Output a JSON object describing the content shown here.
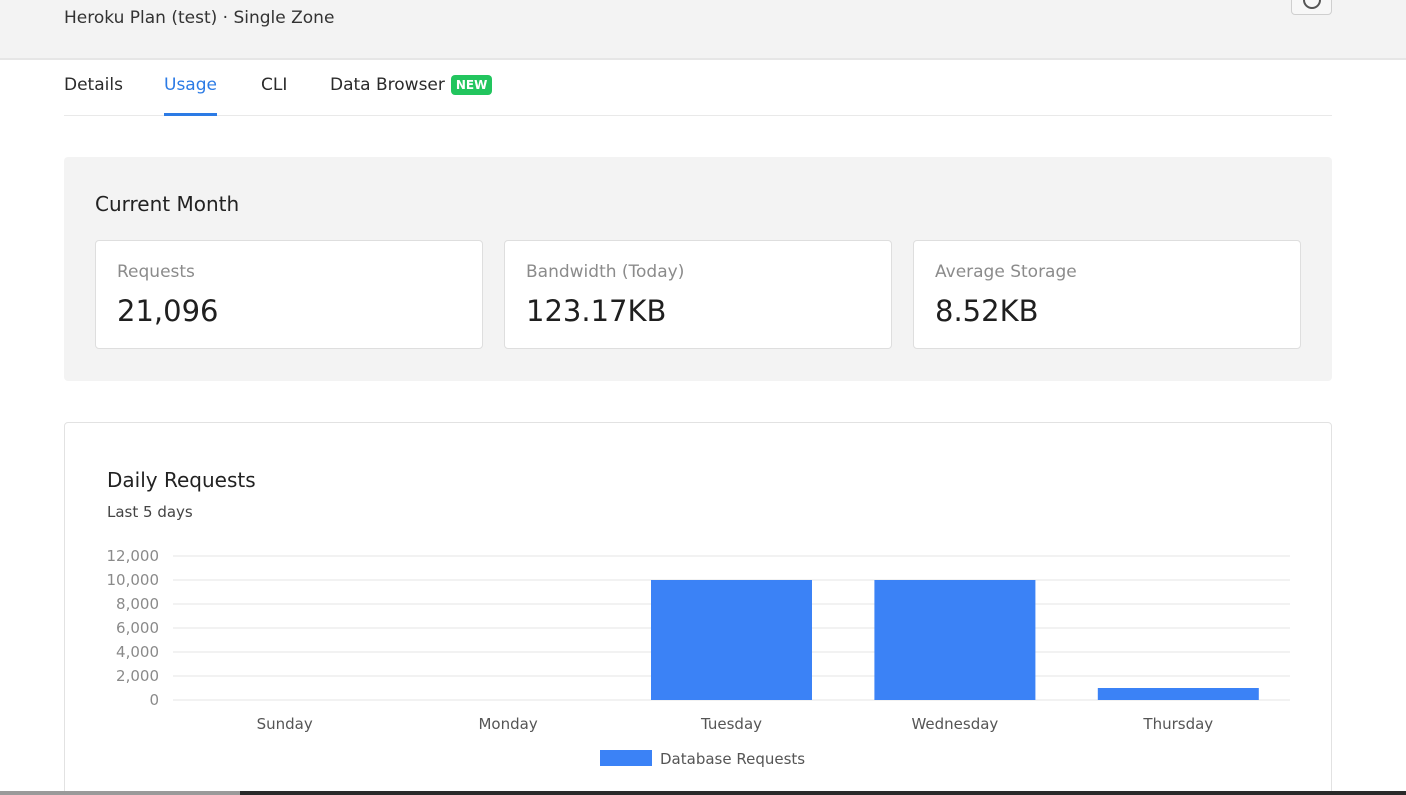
{
  "header": {
    "plan_text": "Heroku Plan (test) · Single Zone",
    "help_icon": "help-circle-icon"
  },
  "tabs": [
    {
      "label": "Details",
      "active": false
    },
    {
      "label": "Usage",
      "active": true
    },
    {
      "label": "CLI",
      "active": false
    },
    {
      "label": "Data Browser",
      "active": false,
      "badge": "NEW"
    }
  ],
  "current_month": {
    "title": "Current Month",
    "stats": [
      {
        "label": "Requests",
        "value": "21,096"
      },
      {
        "label": "Bandwidth (Today)",
        "value": "123.17KB"
      },
      {
        "label": "Average Storage",
        "value": "8.52KB"
      }
    ]
  },
  "daily_requests": {
    "title": "Daily Requests",
    "subtitle": "Last 5 days"
  },
  "colors": {
    "accent": "#2c7be5",
    "bar": "#3b82f6",
    "badge": "#22c55e",
    "panel": "#f3f3f3"
  },
  "chart_data": {
    "type": "bar",
    "categories": [
      "Sunday",
      "Monday",
      "Tuesday",
      "Wednesday",
      "Thursday"
    ],
    "series": [
      {
        "name": "Database Requests",
        "values": [
          0,
          0,
          10000,
          10000,
          1000
        ]
      }
    ],
    "yticks": [
      "0",
      "2,000",
      "4,000",
      "6,000",
      "8,000",
      "10,000",
      "12,000"
    ],
    "ylim": [
      0,
      12000
    ],
    "grid": true,
    "legend": "bottom"
  }
}
